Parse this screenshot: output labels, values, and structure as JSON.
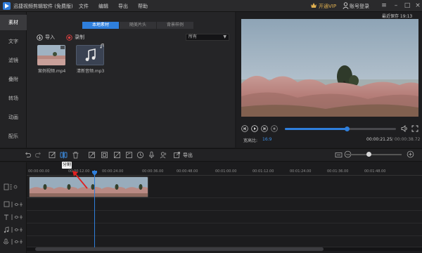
{
  "titlebar": {
    "title": "迅捷视频剪辑软件 (免费版)",
    "menus": [
      "文件",
      "编辑",
      "导出",
      "帮助"
    ],
    "vip_label": "开通VIP",
    "login_label": "账号登录"
  },
  "sidebar": {
    "items": [
      {
        "label": "素材",
        "active": true
      },
      {
        "label": "文字"
      },
      {
        "label": "滤镜"
      },
      {
        "label": "叠附"
      },
      {
        "label": "转场"
      },
      {
        "label": "动画"
      },
      {
        "label": "配乐"
      }
    ]
  },
  "media": {
    "tabs": [
      {
        "label": "本地素材",
        "active": true
      },
      {
        "label": "随美片头"
      },
      {
        "label": "背景样例"
      }
    ],
    "import_label": "导入",
    "record_label": "录制",
    "filter_value": "所有",
    "items": [
      {
        "name": "案例视频.mp4",
        "kind": "video"
      },
      {
        "name": "清新音频.mp3",
        "kind": "audio"
      }
    ]
  },
  "preview": {
    "saved_time": "最近保存 19:13",
    "ratio_label": "宽高比:",
    "ratio_value": "16:9",
    "current_time": "00:00:21.25",
    "total_time": "/ 00:00:38.72",
    "progress": 0.56
  },
  "toolbar": {
    "export_label": "导出",
    "tooltip": "分割",
    "zoom_level": 0.4
  },
  "timeline": {
    "ticks": [
      "00:00:00.00",
      "00:00:12.00",
      "00:00:24.00",
      "00:00:36.00",
      "00:00:48.00",
      "00:01:00.00",
      "00:01:12.00",
      "00:01:24.00",
      "00:01:36.00",
      "00:01:48.00"
    ]
  },
  "colors": {
    "accent": "#2f7fdc",
    "background": "#1b1b1d",
    "vip": "#e0b050"
  }
}
